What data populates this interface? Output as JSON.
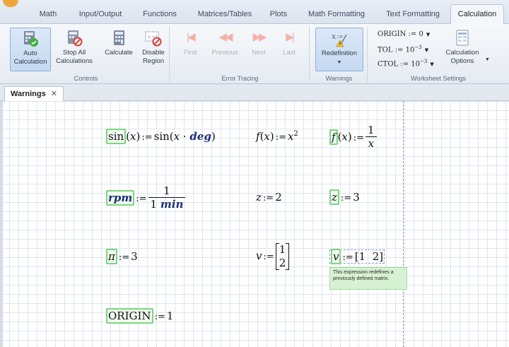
{
  "ribbon_tabs": [
    {
      "label": "Math",
      "active": false
    },
    {
      "label": "Input/Output",
      "active": false
    },
    {
      "label": "Functions",
      "active": false
    },
    {
      "label": "Matrices/Tables",
      "active": false
    },
    {
      "label": "Plots",
      "active": false
    },
    {
      "label": "Math Formatting",
      "active": false
    },
    {
      "label": "Text Formatting",
      "active": false
    },
    {
      "label": "Calculation",
      "active": true
    }
  ],
  "groups": {
    "controls": {
      "label": "Controls",
      "auto_calc_1": "Auto",
      "auto_calc_2": "Calculation",
      "stop_1": "Stop All",
      "stop_2": "Calculations",
      "calculate": "Calculate",
      "disable_1": "Disable",
      "disable_2": "Region"
    },
    "error_tracing": {
      "label": "Error Tracing",
      "first": "First",
      "previous": "Previous",
      "next": "Next",
      "last": "Last"
    },
    "warnings": {
      "label": "Warnings",
      "redefinition": "Redefinition"
    },
    "worksheet_settings": {
      "label": "Worksheet Settings",
      "origin_name": "ORIGIN",
      "origin_value": "0",
      "tol_name": "TOL",
      "tol_base": "10",
      "tol_exp": "−3",
      "ctol_name": "CTOL",
      "ctol_base": "10",
      "ctol_exp": "−3",
      "calc_options_1": "Calculation",
      "calc_options_2": "Options"
    }
  },
  "doc_tab": {
    "label": "Warnings"
  },
  "worksheet": {
    "sin_def": {
      "lhs_fn": "sin",
      "lhs_arg": "x",
      "rhs_fn": "sin",
      "rhs_var": "x",
      "rhs_unit": "deg"
    },
    "f_def_1": {
      "fn": "f",
      "arg": "x",
      "base": "x",
      "exp": "2"
    },
    "f_def_2": {
      "fn": "f",
      "arg": "x",
      "num": "1",
      "den": "x"
    },
    "rpm_def": {
      "name": "rpm",
      "num": "1",
      "den_value": "1",
      "den_unit": "min"
    },
    "z_def_1": {
      "name": "z",
      "value": "2"
    },
    "z_def_2": {
      "name": "z",
      "value": "3"
    },
    "pi_def": {
      "name": "π",
      "value": "3"
    },
    "v_def_1": {
      "name": "v",
      "values": [
        "1",
        "2"
      ]
    },
    "v_def_2": {
      "name": "v",
      "values": [
        "1",
        "2"
      ]
    },
    "origin_def": {
      "name": "ORIGIN",
      "value": "1"
    },
    "tooltip": "This expression redefines a previously defined matrix."
  },
  "colors": {
    "warning_highlight": "#7fd47f",
    "tooltip_bg": "#d7f2d2",
    "unit_blue": "#1a2f7a"
  }
}
